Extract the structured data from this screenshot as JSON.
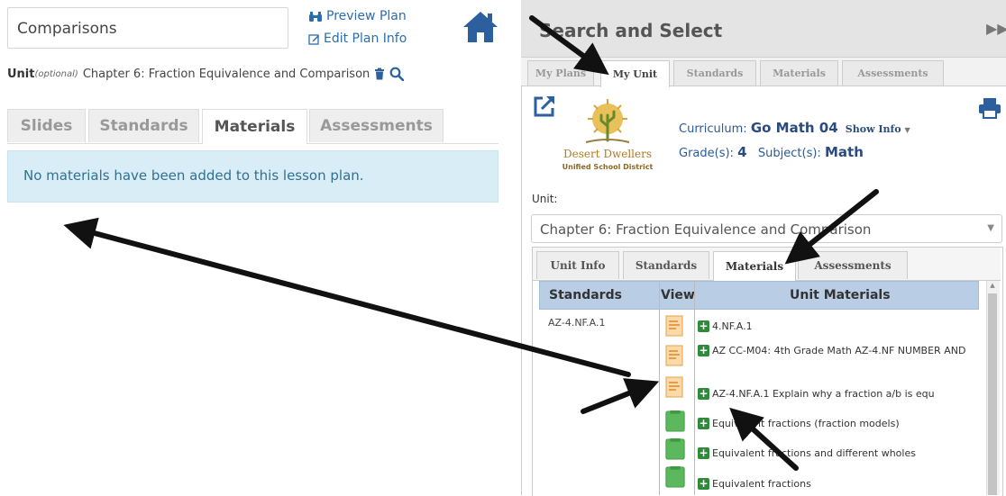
{
  "plan": {
    "title": "Comparisons",
    "preview_label": "Preview Plan",
    "edit_label": "Edit Plan Info",
    "unit_label": "Unit",
    "unit_optional": "(optional)",
    "unit_value": "Chapter 6: Fraction Equivalence and Comparison",
    "tabs": [
      "Slides",
      "Standards",
      "Materials",
      "Assessments"
    ],
    "active_tab": "Materials",
    "empty_message": "No materials have been added to this lesson plan."
  },
  "search": {
    "title": "Search and Select",
    "tabs": [
      "My Plans",
      "My Unit",
      "Standards",
      "Materials",
      "Assessments"
    ],
    "active_tab": "My Unit",
    "logo_name": "Desert Dwellers",
    "logo_sub": "Unified School District",
    "curriculum_label": "Curriculum:",
    "curriculum_value": "Go Math 04",
    "show_info": "Show Info",
    "grade_label": "Grade(s):",
    "grade_value": "4",
    "subject_label": "Subject(s):",
    "subject_value": "Math",
    "unit_label": "Unit:",
    "unit_value": "Chapter 6: Fraction Equivalence and Comparison",
    "inner_tabs": [
      "Unit Info",
      "Standards",
      "Materials",
      "Assessments"
    ],
    "inner_active": "Materials",
    "table": {
      "headers": [
        "Standards",
        "View",
        "Unit Materials"
      ],
      "standard": "AZ-4.NF.A.1",
      "rows": [
        {
          "text": "4.NF.A.1",
          "view": "document"
        },
        {
          "text": "AZ CC-M04: 4th Grade Math AZ-4.NF NUMBER AND",
          "view": "document"
        },
        {
          "text": "AZ-4.NF.A.1 Explain why a fraction a/b is equ",
          "view": "document"
        },
        {
          "text": "Equivalent fractions (fraction models)",
          "view": "green"
        },
        {
          "text": "Equivalent fractions and different wholes",
          "view": "green"
        },
        {
          "text": "Equivalent fractions",
          "view": "green"
        }
      ]
    }
  },
  "colors": {
    "link": "#2a6db0",
    "alert_bg": "#d9edf7",
    "table_head": "#b9cde5",
    "plus_green": "#2e8b3a"
  }
}
